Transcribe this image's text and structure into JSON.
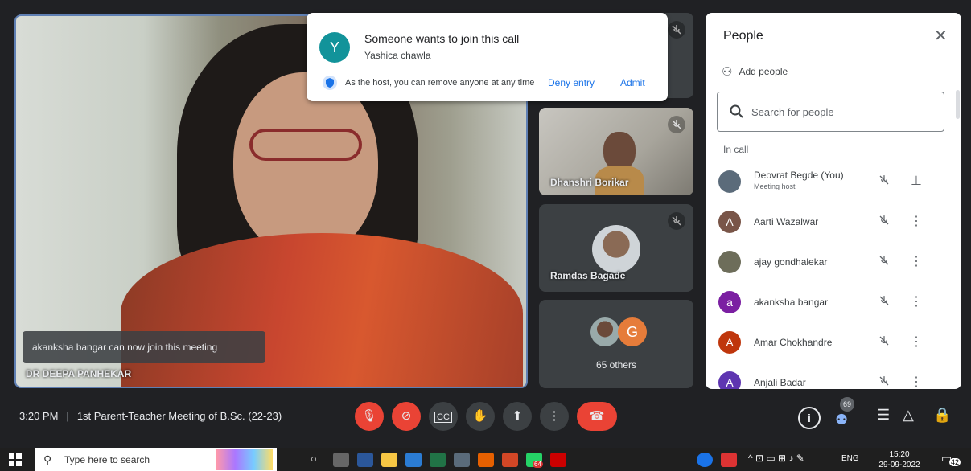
{
  "main_tile": {
    "speaker_name": "DR DEEPA PANHEKAR",
    "toast": "akanksha bangar can now join this meeting"
  },
  "tiles": [
    {
      "name": "Dhanshri Borikar"
    },
    {
      "name": "Ramdas Bagade"
    },
    {
      "others_label": "65 others",
      "avatar_letter": "G"
    }
  ],
  "notification": {
    "avatar_letter": "Y",
    "title": "Someone wants to join this call",
    "requester": "Yashica chawla",
    "host_note": "As the host, you can remove anyone at any time",
    "deny_label": "Deny entry",
    "admit_label": "Admit"
  },
  "people_panel": {
    "title": "People",
    "add_people": "Add people",
    "search_placeholder": "Search for people",
    "section_label": "In call",
    "participants": [
      {
        "name": "Deovrat Begde (You)",
        "subtitle": "Meeting host",
        "letter": "",
        "color": "#5b6b7a"
      },
      {
        "name": "Aarti Wazalwar",
        "subtitle": "",
        "letter": "A",
        "color": "#795548"
      },
      {
        "name": "ajay gondhalekar",
        "subtitle": "",
        "letter": "",
        "color": "#6d6d5a"
      },
      {
        "name": "akanksha bangar",
        "subtitle": "",
        "letter": "a",
        "color": "#7b1fa2"
      },
      {
        "name": "Amar Chokhandre",
        "subtitle": "",
        "letter": "A",
        "color": "#bf360c"
      },
      {
        "name": "Anjali Badar",
        "subtitle": "",
        "letter": "A",
        "color": "#5e35b1"
      }
    ]
  },
  "bottom_bar": {
    "time": "3:20 PM",
    "separator": "|",
    "meeting_title": "1st Parent-Teacher Meeting of B.Sc. (22-23)",
    "people_count": "69"
  },
  "taskbar": {
    "search_placeholder": "Type here to search",
    "lang": "ENG",
    "clock_time": "15:20",
    "clock_date": "29-09-2022",
    "notification_count": "42",
    "badge_64": "64"
  },
  "colors": {
    "accent_blue": "#1a73e8",
    "danger_red": "#ea4335",
    "meet_dark": "#202124"
  }
}
